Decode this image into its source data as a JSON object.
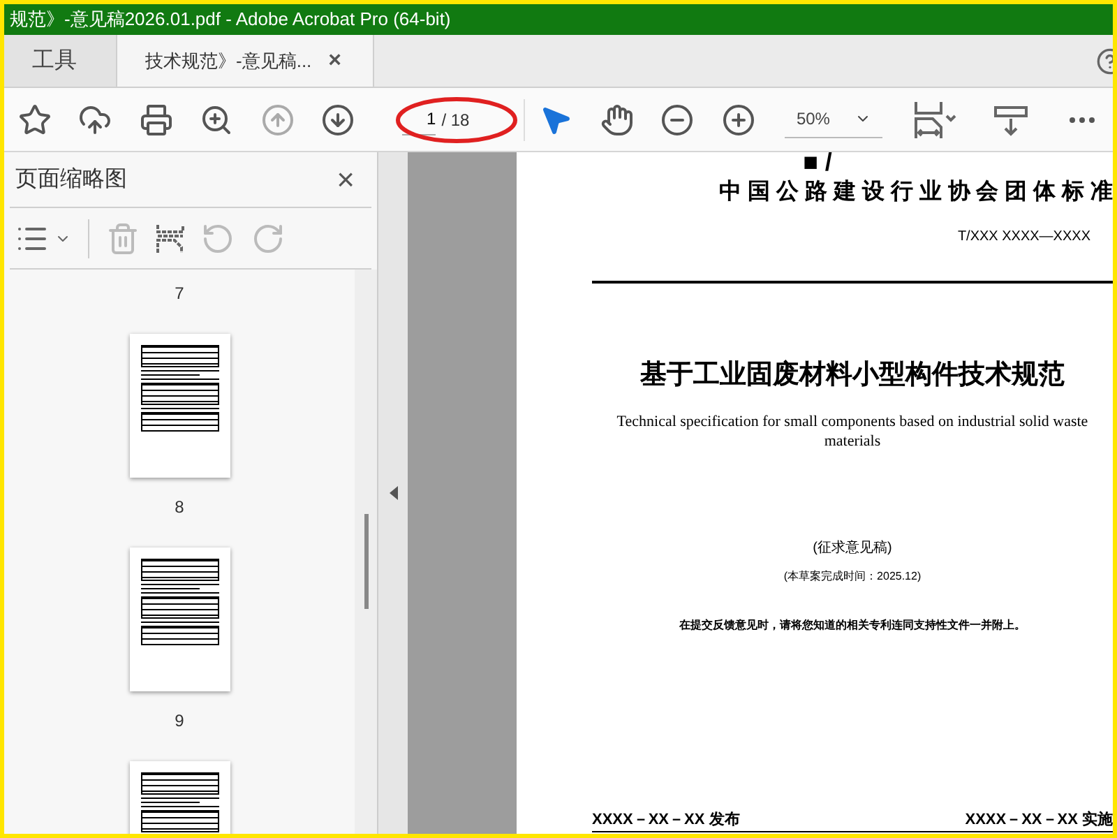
{
  "window": {
    "title": "规范》-意见稿2026.01.pdf - Adobe Acrobat Pro (64-bit)"
  },
  "tabs": [
    {
      "label": "工具",
      "selected": false
    },
    {
      "label": "技术规范》-意见稿...",
      "selected": true,
      "close": "×"
    }
  ],
  "toolbar": {
    "page_field": {
      "value": "1",
      "total": "/ 18"
    },
    "zoom_field": {
      "value": "50%"
    }
  },
  "sidebar": {
    "title": "页面缩略图",
    "close": "×",
    "top_label": "7",
    "thumbnails": [
      {
        "label": "8"
      },
      {
        "label": "9"
      }
    ]
  },
  "document": {
    "fragment": "■ /",
    "header": "中 国 公 路 建 设 行 业 协 会 团 体 标 准",
    "code": "T/XXX XXXX—XXXX",
    "title": "基于工业固废材料小型构件技术规范",
    "subtitle": "Technical specification for small components based on industrial solid waste materials",
    "status": "(征求意见稿)",
    "completion": "(本草案完成时间：2025.12)",
    "notice": "在提交反馈意见时，请将您知道的相关专利连同支持性文件一并附上。",
    "issued": "XXXX－XX－XX 发布",
    "effective": "XXXX－XX－XX 实施"
  }
}
